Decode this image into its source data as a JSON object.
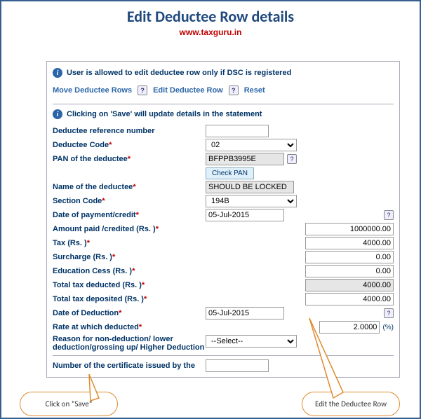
{
  "header": {
    "title": "Edit Deductee Row details",
    "site_link": "www.taxguru.in"
  },
  "info1": "User is allowed to edit deductee row only if DSC is registered",
  "actions": {
    "move": "Move Deductee Rows",
    "edit": "Edit Deductee Row",
    "reset": "Reset"
  },
  "info2": "Clicking on 'Save' will update details in the statement",
  "form": {
    "ref_label": "Deductee reference number",
    "ref_value": "",
    "code_label": "Deductee Code",
    "code_value": "02",
    "pan_label": "PAN of the deductee",
    "pan_value": "BFPPB3995E",
    "check_pan": "Check PAN",
    "name_label": "Name of the deductee",
    "name_value": "SHOULD BE LOCKED",
    "section_label": "Section Code",
    "section_value": "194B",
    "dop_label": "Date of payment/credit",
    "dop_value": "05-Jul-2015",
    "amt_label": "Amount paid /credited (Rs. )",
    "amt_value": "1000000.00",
    "tax_label": "Tax (Rs. )",
    "tax_value": "4000.00",
    "surch_label": "Surcharge (Rs. )",
    "surch_value": "0.00",
    "cess_label": "Education Cess (Rs. )",
    "cess_value": "0.00",
    "total_ded_label": "Total tax deducted (Rs. )",
    "total_ded_value": "4000.00",
    "total_dep_label": "Total tax deposited (Rs. )",
    "total_dep_value": "4000.00",
    "dod_label": "Date of Deduction",
    "dod_value": "05-Jul-2015",
    "rate_label": "Rate at which deducted",
    "rate_value": "2.0000",
    "rate_unit": "(%)",
    "reason_label": "Reason for non-deduction/ lower deduction/grossing up/ Higher Deduction",
    "reason_value": "--Select--",
    "cert_label": "Number of the certificate issued by the"
  },
  "callouts": {
    "left": "Click on “Save”",
    "right": "Edit the Deductee Row"
  }
}
